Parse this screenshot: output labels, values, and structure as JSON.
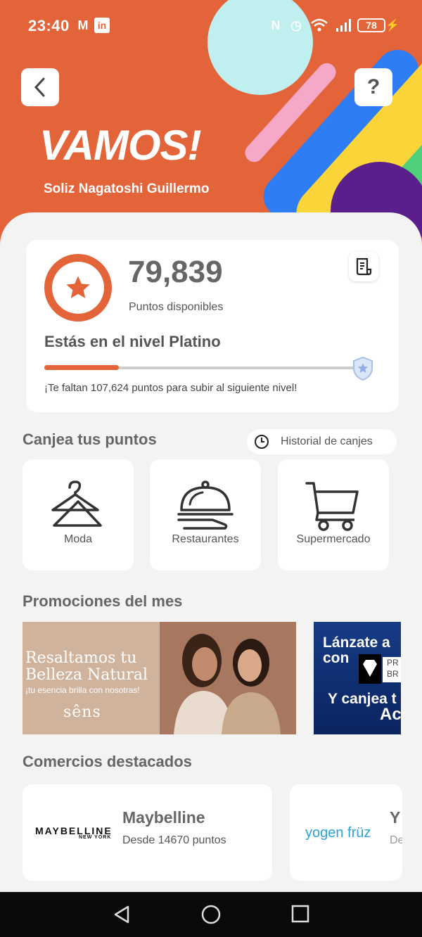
{
  "status_bar": {
    "time": "23:40",
    "battery": "78"
  },
  "header": {
    "logo_text": "VAMOS!",
    "user_name": "Soliz Nagatoshi Guillermo",
    "help_label": "?"
  },
  "points": {
    "value": "79,839",
    "label": "Puntos disponibles",
    "level_text": "Estás en el nivel Platino",
    "progress": 0.235,
    "remaining_text": "¡Te faltan 107,624 puntos para subir al siguiente nivel!"
  },
  "redeem": {
    "title": "Canjea tus puntos",
    "history_label": "Historial de canjes",
    "categories": [
      {
        "label": "Moda",
        "icon": "hanger-icon"
      },
      {
        "label": "Restaurantes",
        "icon": "cloche-icon"
      },
      {
        "label": "Supermercado",
        "icon": "cart-icon"
      }
    ]
  },
  "promos": {
    "title": "Promociones del mes",
    "items": [
      {
        "headline1": "Resaltamos tu",
        "headline2": "Belleza Natural",
        "subline": "¡tu esencia brilla con nosotras!",
        "brand": "sêns"
      },
      {
        "line1": "Lánzate a",
        "line2": "con",
        "line3": "Y canjea t",
        "line4": "Ac",
        "brand_partial": "PR BR"
      }
    ]
  },
  "merchants": {
    "title": "Comercios destacados",
    "items": [
      {
        "logo": "MAYBELLINE",
        "logo_sub": "NEW YORK",
        "name": "Maybelline",
        "points": "Desde 14670 puntos"
      },
      {
        "logo": "yogen früz",
        "name": "Y",
        "points": "De"
      }
    ]
  },
  "colors": {
    "brand": "#e4643a",
    "background": "#f3f3f3"
  }
}
